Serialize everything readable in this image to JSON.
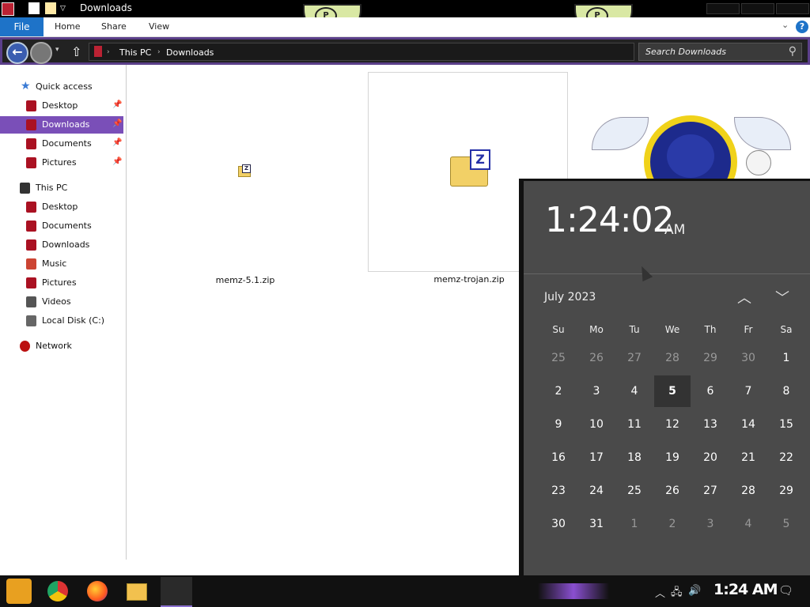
{
  "window": {
    "title": "Downloads"
  },
  "ribbon": {
    "tabs": [
      "File",
      "Home",
      "Share",
      "View"
    ],
    "help": "?"
  },
  "address": {
    "crumbs": [
      "This PC",
      "Downloads"
    ],
    "search_placeholder": "Search Downloads"
  },
  "sidebar": {
    "quick_access": {
      "label": "Quick access",
      "items": [
        {
          "label": "Desktop",
          "pinned": true,
          "icon": "desktop-folder-icon"
        },
        {
          "label": "Downloads",
          "pinned": true,
          "selected": true,
          "icon": "downloads-folder-icon"
        },
        {
          "label": "Documents",
          "pinned": true,
          "icon": "documents-folder-icon"
        },
        {
          "label": "Pictures",
          "pinned": true,
          "icon": "pictures-folder-icon"
        }
      ]
    },
    "this_pc": {
      "label": "This PC",
      "items": [
        {
          "label": "Desktop",
          "icon": "desktop-folder-icon"
        },
        {
          "label": "Documents",
          "icon": "documents-folder-icon"
        },
        {
          "label": "Downloads",
          "icon": "downloads-folder-icon"
        },
        {
          "label": "Music",
          "icon": "music-folder-icon"
        },
        {
          "label": "Pictures",
          "icon": "pictures-folder-icon"
        },
        {
          "label": "Videos",
          "icon": "videos-folder-icon"
        },
        {
          "label": "Local Disk (C:)",
          "icon": "drive-icon"
        }
      ]
    },
    "network": {
      "label": "Network"
    }
  },
  "files": [
    {
      "name": "memz-5.1.zip",
      "icon": "zip-folder-icon",
      "selected": false
    },
    {
      "name": "memz-trojan.zip",
      "icon": "zip-folder-icon",
      "selected": true
    }
  ],
  "flyout": {
    "time": "1:24:02",
    "ampm": "AM",
    "month": "July 2023",
    "weekdays": [
      "Su",
      "Mo",
      "Tu",
      "We",
      "Th",
      "Fr",
      "Sa"
    ],
    "weeks": [
      [
        "25",
        "26",
        "27",
        "28",
        "29",
        "30",
        "1"
      ],
      [
        "2",
        "3",
        "4",
        "5",
        "6",
        "7",
        "8"
      ],
      [
        "9",
        "10",
        "11",
        "12",
        "13",
        "14",
        "15"
      ],
      [
        "16",
        "17",
        "18",
        "19",
        "20",
        "21",
        "22"
      ],
      [
        "23",
        "24",
        "25",
        "26",
        "27",
        "28",
        "29"
      ],
      [
        "30",
        "31",
        "1",
        "2",
        "3",
        "4",
        "5"
      ]
    ],
    "today": "5"
  },
  "taskbar": {
    "clock": "1:24 AM",
    "apps": [
      "start-icon",
      "chrome-icon",
      "firefox-icon",
      "file-explorer-icon",
      "sonic-app-icon"
    ]
  },
  "colors": {
    "accent": "#7a4fb8",
    "file_tab": "#1e73c8",
    "flyout_bg": "#4a4a4a"
  }
}
